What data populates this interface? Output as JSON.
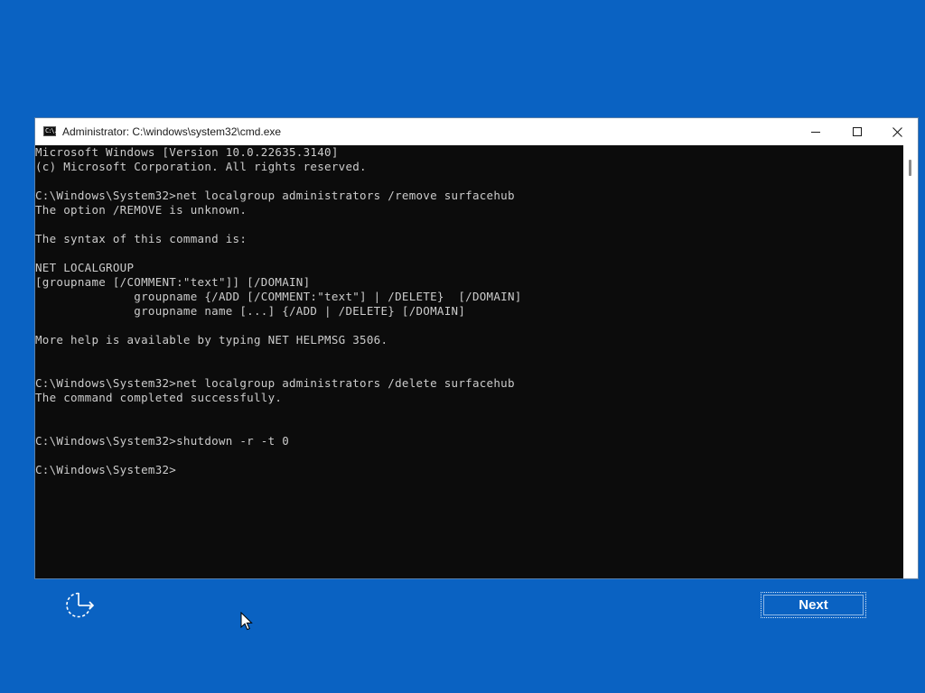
{
  "window": {
    "title": "Administrator: C:\\windows\\system32\\cmd.exe",
    "icon": "cmd-app-icon",
    "icon_text": "C:\\."
  },
  "console": {
    "lines": [
      "Microsoft Windows [Version 10.0.22635.3140]",
      "(c) Microsoft Corporation. All rights reserved.",
      "",
      "C:\\Windows\\System32>net localgroup administrators /remove surfacehub",
      "The option /REMOVE is unknown.",
      "",
      "The syntax of this command is:",
      "",
      "NET LOCALGROUP",
      "[groupname [/COMMENT:\"text\"]] [/DOMAIN]",
      "              groupname {/ADD [/COMMENT:\"text\"] | /DELETE}  [/DOMAIN]",
      "              groupname name [...] {/ADD | /DELETE} [/DOMAIN]",
      "",
      "More help is available by typing NET HELPMSG 3506.",
      "",
      "",
      "C:\\Windows\\System32>net localgroup administrators /delete surfacehub",
      "The command completed successfully.",
      "",
      "",
      "C:\\Windows\\System32>shutdown -r -t 0",
      "",
      "C:\\Windows\\System32>"
    ]
  },
  "footer": {
    "next_label": "Next",
    "accessibility_icon": "ease-of-access-icon"
  },
  "colors": {
    "desktop_background": "#0a62c2",
    "console_background": "#0c0c0c",
    "console_text": "#cccccc",
    "titlebar_background": "#ffffff"
  }
}
